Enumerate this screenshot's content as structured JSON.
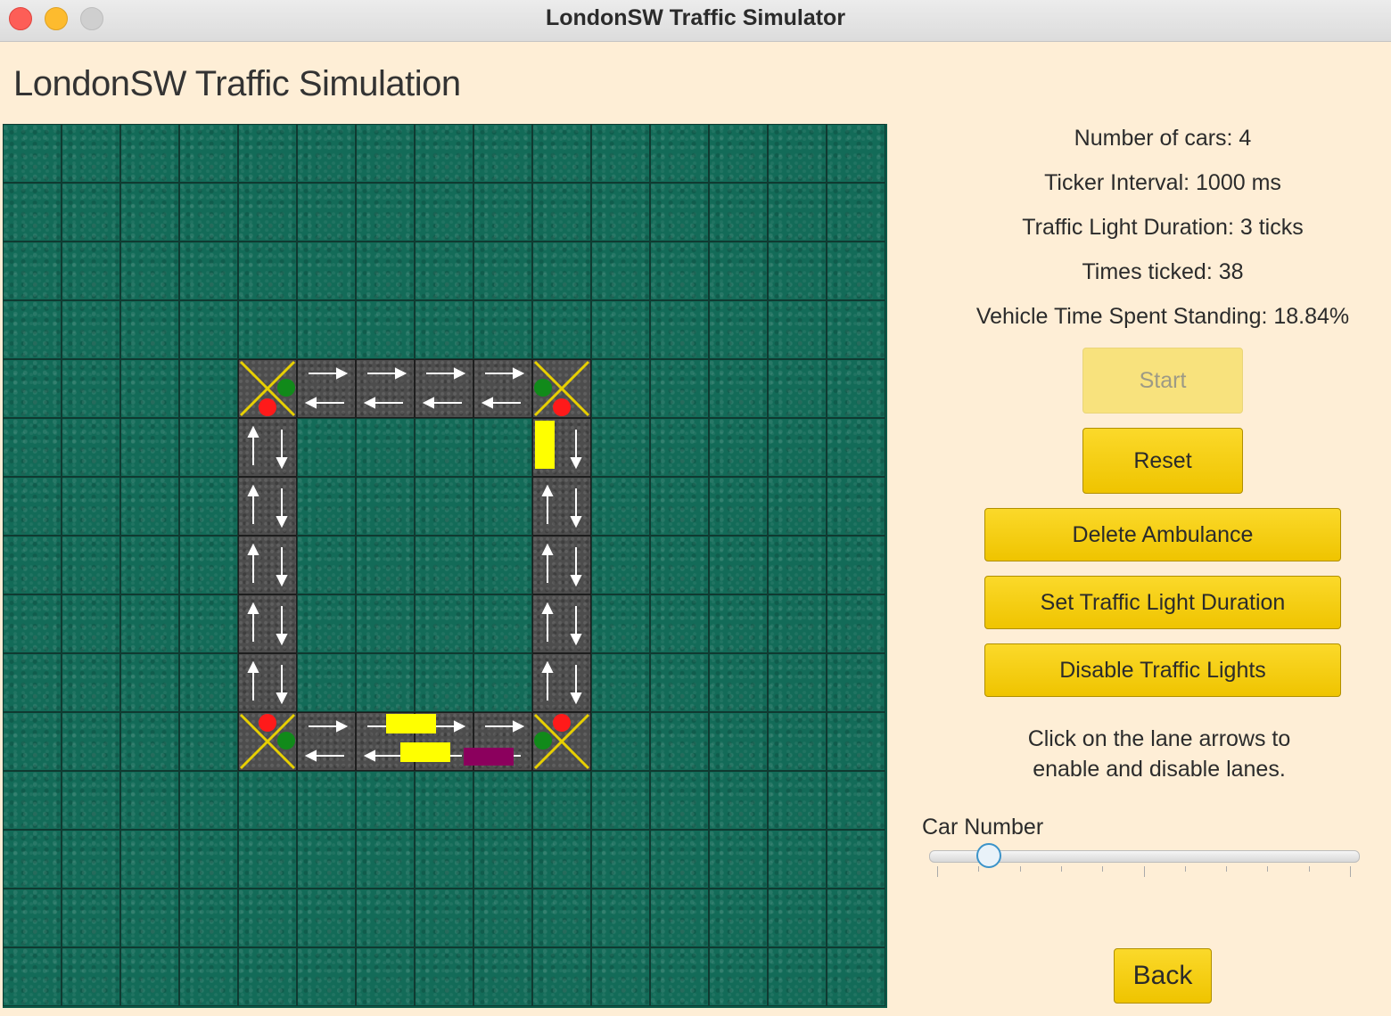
{
  "window": {
    "title": "LondonSW Traffic Simulator"
  },
  "page": {
    "title": "LondonSW Traffic Simulation"
  },
  "stats": {
    "cars": "Number of cars: 4",
    "ticker": "Ticker Interval: 1000 ms",
    "light_duration": "Traffic Light Duration: 3 ticks",
    "ticks": "Times ticked: 38",
    "standing": "Vehicle Time Spent Standing: 18.84%"
  },
  "buttons": {
    "start": "Start",
    "reset": "Reset",
    "delete_ambulance": "Delete Ambulance",
    "set_duration": "Set Traffic Light Duration",
    "disable_lights": "Disable Traffic Lights",
    "back": "Back"
  },
  "hint": {
    "line1": "Click on the lane arrows to",
    "line2": "enable and disable lanes."
  },
  "slider": {
    "label": "Car Number",
    "value_fraction": 0.14
  },
  "grid": {
    "rows": 15,
    "cols": 15
  },
  "map": {
    "junctions": [
      {
        "row": 4,
        "col": 4,
        "lights": [
          "green-right",
          "red-bottom"
        ]
      },
      {
        "row": 4,
        "col": 9,
        "lights": [
          "green-left",
          "red-bottom"
        ]
      },
      {
        "row": 10,
        "col": 4,
        "lights": [
          "red-top",
          "green-right"
        ]
      },
      {
        "row": 10,
        "col": 9,
        "lights": [
          "red-top",
          "green-left"
        ]
      }
    ],
    "horizontal_roads": [
      {
        "row": 4,
        "cols": [
          5,
          6,
          7,
          8
        ]
      },
      {
        "row": 10,
        "cols": [
          5,
          6,
          7,
          8
        ]
      }
    ],
    "vertical_roads": [
      {
        "col": 4,
        "rows": [
          5,
          6,
          7,
          8,
          9
        ]
      },
      {
        "col": 9,
        "rows": [
          5,
          6,
          7,
          8,
          9
        ]
      }
    ],
    "cars": [
      {
        "type": "car",
        "color": "#ffff00",
        "row": 5,
        "col": 9,
        "lane": "up"
      },
      {
        "type": "car",
        "color": "#ffff00",
        "row": 10,
        "col": 6,
        "lane": "right"
      },
      {
        "type": "car",
        "color": "#ffff00",
        "row": 10,
        "col": 6,
        "lane": "left"
      },
      {
        "type": "ambulance",
        "color": "#8b005d",
        "row": 10,
        "col": 7,
        "lane": "left"
      }
    ]
  },
  "colors": {
    "accent": "#f2c800",
    "grass": "#136b58",
    "road": "#4d4d4d",
    "red_light": "#ff1a1a",
    "green_light": "#118a1a"
  }
}
